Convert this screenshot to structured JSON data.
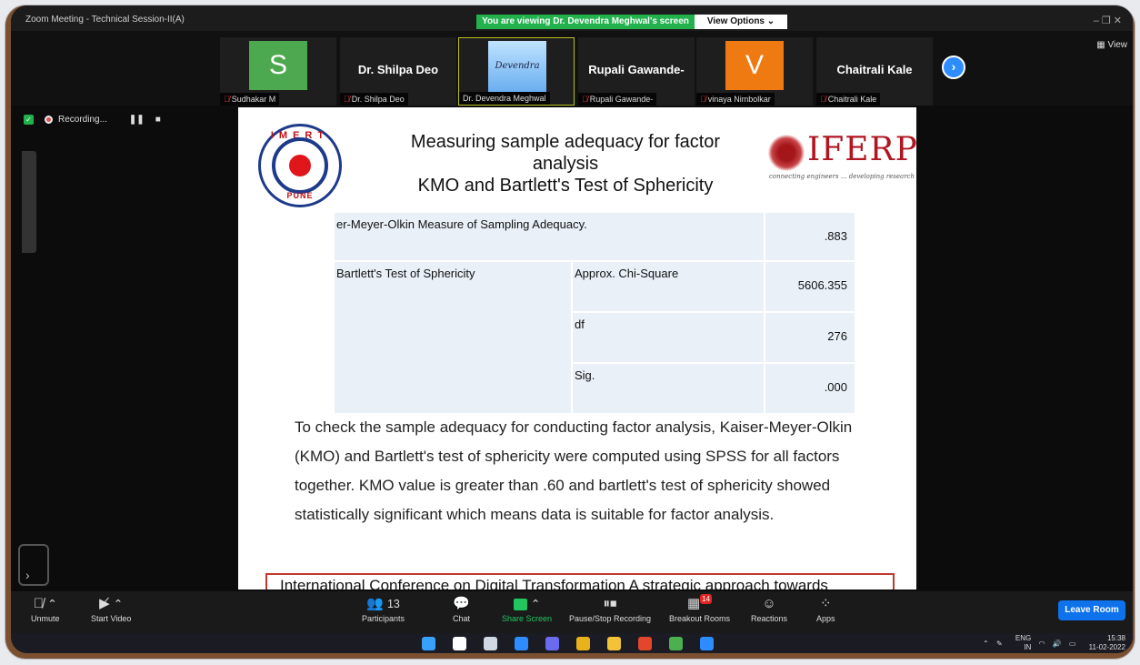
{
  "window": {
    "title": "Zoom Meeting - Technical Session-II(A)",
    "controls": "–  ❐  ✕"
  },
  "banner": {
    "viewing": "You are viewing Dr. Devendra Meghwal's screen",
    "view_options": "View Options ⌄"
  },
  "gallery": {
    "tiles": [
      {
        "display": "S",
        "display_type": "avatar",
        "color": "#4ca94f",
        "name": "Sudhakar M",
        "muted": true
      },
      {
        "display": "Dr. Shilpa Deo",
        "display_type": "text",
        "name": "Dr. Shilpa Deo",
        "muted": true
      },
      {
        "display": "Devendra",
        "display_type": "video",
        "name": "Dr. Devendra Meghwal",
        "muted": false,
        "active": true
      },
      {
        "display": "Rupali Gawande-",
        "display_type": "text",
        "name": "Rupali Gawande-",
        "muted": true
      },
      {
        "display": "V",
        "display_type": "avatar",
        "color": "#ef7a12",
        "name": "vinaya Nimbolkar",
        "muted": true
      },
      {
        "display": "Chaitrali Kale",
        "display_type": "text",
        "name": "Chaitrali Kale",
        "muted": true
      }
    ],
    "next_icon": "chevron-right-icon",
    "view_label": "View"
  },
  "recording": {
    "status": "Recording...",
    "pause": "❚❚",
    "stop": "■"
  },
  "slide": {
    "title_line1": "Measuring sample adequacy for factor",
    "title_line2": "analysis",
    "title_line3": "KMO and Bartlett's Test of Sphericity",
    "left_logo": {
      "top_text": "IMERT",
      "bottom_text": "PUNE"
    },
    "right_logo": {
      "brand": "IFERP",
      "tagline": "connecting engineers ... developing research"
    },
    "table": [
      {
        "label": "er-Meyer-Olkin Measure of Sampling Adequacy.",
        "test": "",
        "value": ".883"
      },
      {
        "label": "Bartlett's Test of Sphericity",
        "test": "Approx. Chi-Square",
        "value": "5606.355"
      },
      {
        "label": "",
        "test": "df",
        "value": "276"
      },
      {
        "label": "",
        "test": "Sig.",
        "value": ".000"
      }
    ],
    "paragraph": "To check the sample adequacy for conducting factor analysis, Kaiser-Meyer-Olkin (KMO) and Bartlett's test of sphericity were computed using SPSS for all factors together.  KMO value is greater than .60 and bartlett's test of sphericity showed statistically significant which means data is suitable for factor analysis.",
    "footer": "International Conference on Digital Transformation A strategic approach towards"
  },
  "toolbar": {
    "unmute": "Unmute",
    "start_video": "Start Video",
    "participants": "Participants",
    "participants_count": "13",
    "chat": "Chat",
    "share_screen": "Share Screen",
    "pause_stop_recording": "Pause/Stop Recording",
    "breakout_rooms": "Breakout Rooms",
    "breakout_badge": "14",
    "reactions": "Reactions",
    "apps": "Apps",
    "leave_room": "Leave Room"
  },
  "taskbar": {
    "apps": [
      {
        "icon": "windows-start-icon",
        "color": "#3aa0ff"
      },
      {
        "icon": "search-icon",
        "color": "#ffffff"
      },
      {
        "icon": "task-view-icon",
        "color": "#cfd8e3"
      },
      {
        "icon": "widgets-icon",
        "color": "#2d8cff"
      },
      {
        "icon": "teams-chat-icon",
        "color": "#6b6bf0"
      },
      {
        "icon": "chrome-icon",
        "color": "#e8b21a"
      },
      {
        "icon": "file-explorer-icon",
        "color": "#f3c237"
      },
      {
        "icon": "office-icon",
        "color": "#e2472b"
      },
      {
        "icon": "chrome-profile-icon",
        "color": "#4caf50"
      },
      {
        "icon": "zoom-icon",
        "color": "#2d8cff"
      }
    ],
    "language": "ENG",
    "region": "IN",
    "time": "15:38",
    "date": "11-02-2022"
  }
}
